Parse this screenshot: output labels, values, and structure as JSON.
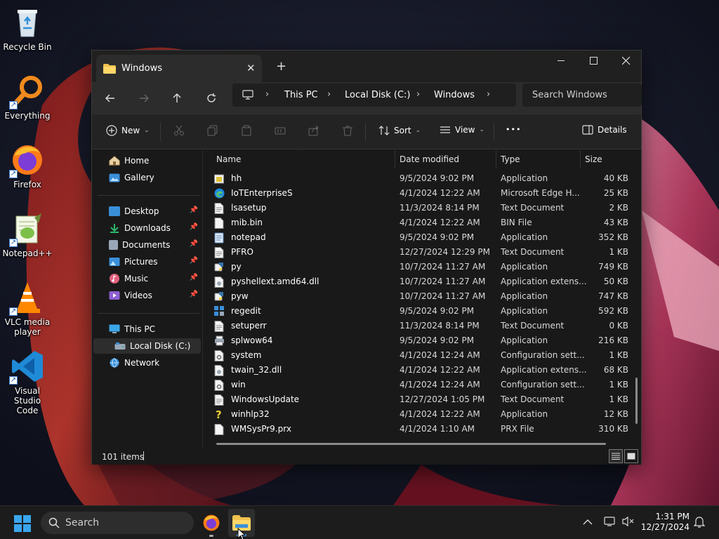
{
  "desktop": {
    "icons": [
      {
        "label": "Recycle Bin",
        "icon": "recycle-bin-icon"
      },
      {
        "label": "Everything",
        "icon": "everything-search-icon"
      },
      {
        "label": "Firefox",
        "icon": "firefox-icon"
      },
      {
        "label": "Notepad++",
        "icon": "notepad-plus-plus-icon"
      },
      {
        "label": "VLC media player",
        "icon": "vlc-cone-icon"
      },
      {
        "label": "Visual Studio Code",
        "icon": "vscode-icon"
      }
    ]
  },
  "window": {
    "tab_title": "Windows",
    "new_tab": "+",
    "controls": {
      "minimize": "—",
      "maximize": "☐",
      "close": "✕"
    }
  },
  "address": {
    "segments": [
      "This PC",
      "Local Disk (C:)",
      "Windows"
    ],
    "search_placeholder": "Search Windows"
  },
  "toolbar": {
    "new_label": "New",
    "sort_label": "Sort",
    "view_label": "View",
    "more_label": "•••",
    "details_label": "Details"
  },
  "nav": {
    "quick": [
      {
        "label": "Home",
        "icon": "home-icon"
      },
      {
        "label": "Gallery",
        "icon": "gallery-icon"
      }
    ],
    "pinned": [
      {
        "label": "Desktop",
        "icon": "desktop-folder-icon",
        "color": "#3a8fd9"
      },
      {
        "label": "Downloads",
        "icon": "downloads-icon",
        "color": "#2fb36a"
      },
      {
        "label": "Documents",
        "icon": "documents-icon",
        "color": "#9aa7b8"
      },
      {
        "label": "Pictures",
        "icon": "pictures-icon",
        "color": "#3a8fd9"
      },
      {
        "label": "Music",
        "icon": "music-icon",
        "color": "#e0607e"
      },
      {
        "label": "Videos",
        "icon": "videos-icon",
        "color": "#8d5fd3"
      }
    ],
    "this_pc": "This PC",
    "local_disk": "Local Disk (C:)",
    "network": "Network"
  },
  "columns": {
    "name": "Name",
    "date": "Date modified",
    "type": "Type",
    "size": "Size"
  },
  "files": [
    {
      "name": "hh",
      "date": "9/5/2024 9:02 PM",
      "type": "Application",
      "size": "40 KB",
      "icon": "app-help-icon"
    },
    {
      "name": "IoTEnterpriseS",
      "date": "4/1/2024 12:22 AM",
      "type": "Microsoft Edge H...",
      "size": "25 KB",
      "icon": "edge-icon"
    },
    {
      "name": "lsasetup",
      "date": "11/3/2024 8:14 PM",
      "type": "Text Document",
      "size": "2 KB",
      "icon": "text-file-icon"
    },
    {
      "name": "mib.bin",
      "date": "4/1/2024 12:22 AM",
      "type": "BIN File",
      "size": "43 KB",
      "icon": "generic-file-icon"
    },
    {
      "name": "notepad",
      "date": "9/5/2024 9:02 PM",
      "type": "Application",
      "size": "352 KB",
      "icon": "notepad-icon"
    },
    {
      "name": "PFRO",
      "date": "12/27/2024 12:29 PM",
      "type": "Text Document",
      "size": "1 KB",
      "icon": "text-file-icon"
    },
    {
      "name": "py",
      "date": "10/7/2024 11:27 AM",
      "type": "Application",
      "size": "749 KB",
      "icon": "python-launcher-icon"
    },
    {
      "name": "pyshellext.amd64.dll",
      "date": "10/7/2024 11:27 AM",
      "type": "Application extens...",
      "size": "50 KB",
      "icon": "dll-icon"
    },
    {
      "name": "pyw",
      "date": "10/7/2024 11:27 AM",
      "type": "Application",
      "size": "747 KB",
      "icon": "python-launcher-icon"
    },
    {
      "name": "regedit",
      "date": "9/5/2024 9:02 PM",
      "type": "Application",
      "size": "592 KB",
      "icon": "registry-editor-icon"
    },
    {
      "name": "setuperr",
      "date": "11/3/2024 8:14 PM",
      "type": "Text Document",
      "size": "0 KB",
      "icon": "text-file-icon"
    },
    {
      "name": "splwow64",
      "date": "9/5/2024 9:02 PM",
      "type": "Application",
      "size": "216 KB",
      "icon": "printer-icon"
    },
    {
      "name": "system",
      "date": "4/1/2024 12:24 AM",
      "type": "Configuration sett...",
      "size": "1 KB",
      "icon": "config-file-icon"
    },
    {
      "name": "twain_32.dll",
      "date": "4/1/2024 12:22 AM",
      "type": "Application extens...",
      "size": "68 KB",
      "icon": "dll-icon"
    },
    {
      "name": "win",
      "date": "4/1/2024 12:24 AM",
      "type": "Configuration sett...",
      "size": "1 KB",
      "icon": "config-file-icon"
    },
    {
      "name": "WindowsUpdate",
      "date": "12/27/2024 1:05 PM",
      "type": "Text Document",
      "size": "1 KB",
      "icon": "text-file-icon"
    },
    {
      "name": "winhlp32",
      "date": "4/1/2024 12:22 AM",
      "type": "Application",
      "size": "12 KB",
      "icon": "help-question-icon"
    },
    {
      "name": "WMSysPr9.prx",
      "date": "4/1/2024 1:10 AM",
      "type": "PRX File",
      "size": "310 KB",
      "icon": "generic-file-icon"
    }
  ],
  "status": {
    "item_count": "101 items"
  },
  "taskbar": {
    "search_label": "Search",
    "time": "1:31 PM",
    "date": "12/27/2024"
  },
  "colors": {
    "accent": "#0078d4",
    "folder": "#f2c14e",
    "window_bg": "#191919"
  }
}
